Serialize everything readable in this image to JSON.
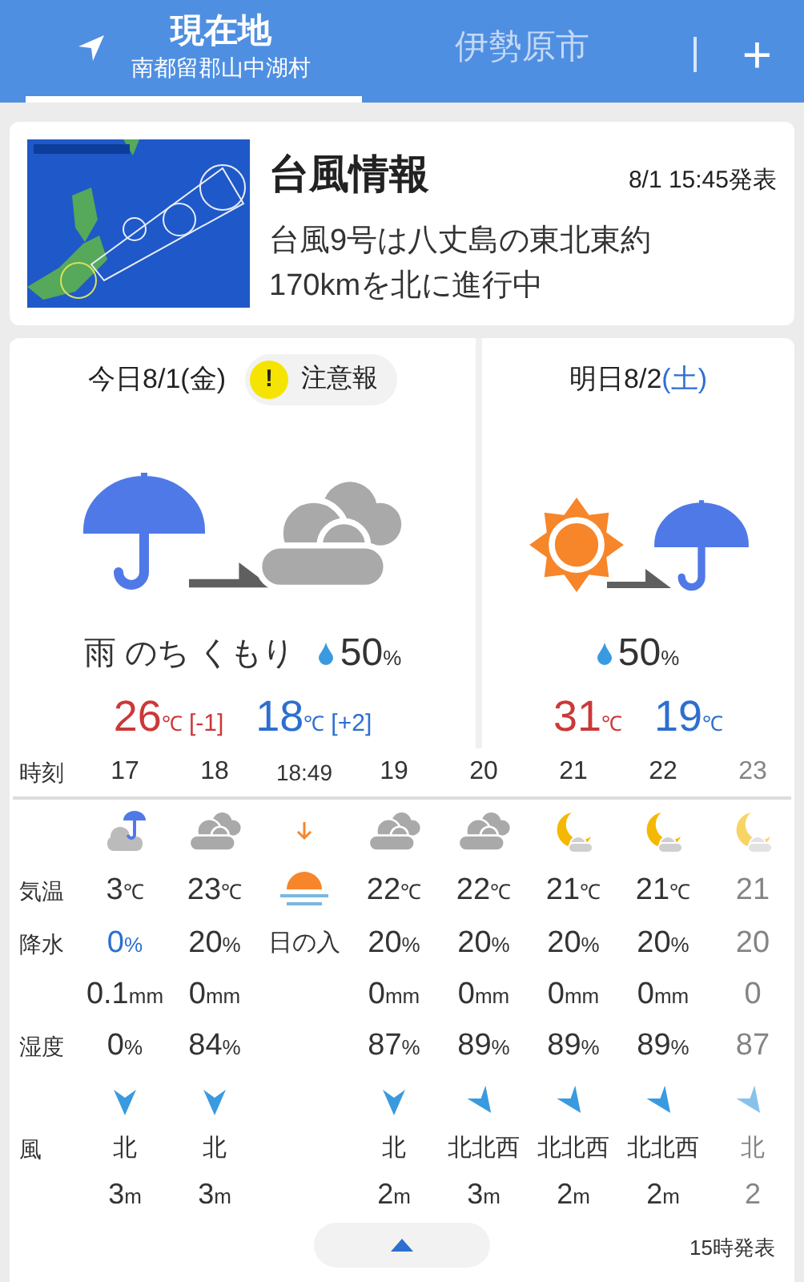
{
  "tabs": [
    {
      "title": "現在地",
      "subtitle": "南都留郡山中湖村",
      "selected": true,
      "kind": "location"
    },
    {
      "title": "伊勢原市",
      "selected": false,
      "kind": "city"
    }
  ],
  "add_button": "+",
  "typhoon": {
    "title": "台風情報",
    "time": "8/1 15:45発表",
    "text": "台風9号は八丈島の東北東約170kmを北に進行中"
  },
  "days": [
    {
      "date": "今日8/1",
      "weekday": "(金)",
      "warning": {
        "icon": "!",
        "label": "注意報"
      },
      "weather": [
        {
          "kind": "rain"
        },
        {
          "kind": "cloudy"
        }
      ],
      "summary": "雨 のち くもり",
      "precip": "50",
      "precip_unit": "%",
      "high": "26",
      "high_unit": "℃",
      "high_diff": "[-1]",
      "low": "18",
      "low_unit": "℃",
      "low_diff": "[+2]"
    },
    {
      "date": "明日8/2",
      "weekday": "(土)",
      "color": "#2d6fd0",
      "weather": [
        {
          "kind": "sunny"
        },
        {
          "kind": "rain"
        }
      ],
      "precip": "50",
      "precip_unit": "%",
      "high": "31",
      "high_unit": "℃",
      "low": "19",
      "low_unit": "℃"
    }
  ],
  "hourly": {
    "labels": {
      "time": "時刻",
      "temp": "気温",
      "precip": "降水",
      "humidity": "湿度",
      "wind": "風"
    },
    "columns": [
      {
        "kind": "rain-cloudy",
        "time": "17",
        "temp": "3",
        "temp_unit": "℃",
        "precip": "0",
        "precip_unit": "%",
        "rain": "0.1",
        "rain_unit": "mm",
        "humidity": "0",
        "humidity_unit": "%",
        "wind": {
          "kind": "south",
          "direction": "北",
          "speed": "3",
          "unit": "m"
        },
        "faded": false
      },
      {
        "kind": "cloudy",
        "time": "18",
        "temp": "23",
        "temp_unit": "℃",
        "precip": "20",
        "precip_unit": "%",
        "rain": "0",
        "rain_unit": "mm",
        "humidity": "84",
        "humidity_unit": "%",
        "wind": {
          "kind": "south",
          "direction": "北",
          "speed": "3",
          "unit": "m"
        },
        "faded": false
      },
      {
        "kind": "sunset",
        "time": "18:49",
        "label": "日の入",
        "faded": false
      },
      {
        "kind": "cloudy",
        "time": "19",
        "temp": "22",
        "temp_unit": "℃",
        "precip": "20",
        "precip_unit": "%",
        "rain": "0",
        "rain_unit": "mm",
        "humidity": "87",
        "humidity_unit": "%",
        "wind": {
          "kind": "south",
          "direction": "北",
          "speed": "2",
          "unit": "m"
        },
        "faded": false
      },
      {
        "kind": "cloudy",
        "time": "20",
        "temp": "22",
        "temp_unit": "℃",
        "precip": "20",
        "precip_unit": "%",
        "rain": "0",
        "rain_unit": "mm",
        "humidity": "89",
        "humidity_unit": "%",
        "wind": {
          "kind": "southeast",
          "direction": "北北西",
          "speed": "3",
          "unit": "m"
        },
        "faded": false
      },
      {
        "kind": "night-cloudy",
        "time": "21",
        "temp": "21",
        "temp_unit": "℃",
        "precip": "20",
        "precip_unit": "%",
        "rain": "0",
        "rain_unit": "mm",
        "humidity": "89",
        "humidity_unit": "%",
        "wind": {
          "kind": "southeast",
          "direction": "北北西",
          "speed": "2",
          "unit": "m"
        },
        "faded": false
      },
      {
        "kind": "night-cloudy",
        "time": "22",
        "temp": "21",
        "temp_unit": "℃",
        "precip": "20",
        "precip_unit": "%",
        "rain": "0",
        "rain_unit": "mm",
        "humidity": "89",
        "humidity_unit": "%",
        "wind": {
          "kind": "southeast",
          "direction": "北北西",
          "speed": "2",
          "unit": "m"
        },
        "faded": false
      },
      {
        "kind": "night-cloudy",
        "time": "23",
        "temp": "21",
        "precip": "20",
        "rain": "0",
        "humidity": "87",
        "wind": {
          "kind": "southeast",
          "direction": "北",
          "speed": "2"
        },
        "faded": true
      }
    ],
    "issued": "15時発表"
  }
}
